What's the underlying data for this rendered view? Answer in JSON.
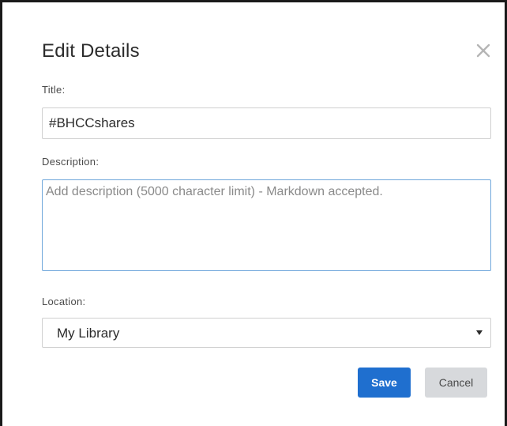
{
  "dialog": {
    "title": "Edit Details",
    "close_icon": "close-icon"
  },
  "fields": {
    "title_label": "Title:",
    "title_value": "#BHCCshares",
    "description_label": "Description:",
    "description_value": "",
    "description_placeholder": "Add description (5000 character limit) - Markdown accepted.",
    "location_label": "Location:",
    "location_value": "My Library"
  },
  "buttons": {
    "save_label": "Save",
    "cancel_label": "Cancel"
  },
  "colors": {
    "primary_button": "#1f6fcf",
    "secondary_button": "#d7d9dc",
    "focus_border": "#6fa7db"
  }
}
